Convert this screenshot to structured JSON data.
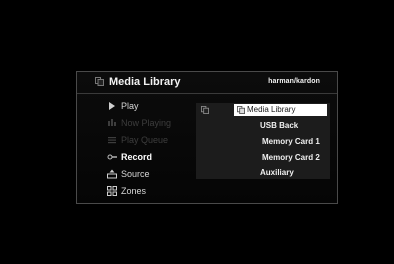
{
  "header": {
    "title": "Media Library",
    "brand": "harman/kardon",
    "icon": "media-library-icon"
  },
  "menu": {
    "items": [
      {
        "label": "Play",
        "icon": "play-icon",
        "state": "active"
      },
      {
        "label": "Now Playing",
        "icon": "now-playing-icon",
        "state": "disabled"
      },
      {
        "label": "Play Queue",
        "icon": "play-queue-icon",
        "state": "disabled"
      },
      {
        "label": "Record",
        "icon": "record-icon",
        "state": "selected"
      },
      {
        "label": "Source",
        "icon": "source-icon",
        "state": "active"
      },
      {
        "label": "Zones",
        "icon": "zones-icon",
        "state": "active"
      }
    ]
  },
  "sources": {
    "selected": "Media Library",
    "items": [
      "Media Library",
      "USB Back",
      "Memory Card 1",
      "Memory Card 2",
      "Auxiliary"
    ]
  },
  "colors": {
    "background": "#000000",
    "panel_border": "#4a4a4a",
    "source_list_bg": "#1c1c1c",
    "highlight": "#ffffff",
    "dim_text": "#3d3d3d"
  }
}
